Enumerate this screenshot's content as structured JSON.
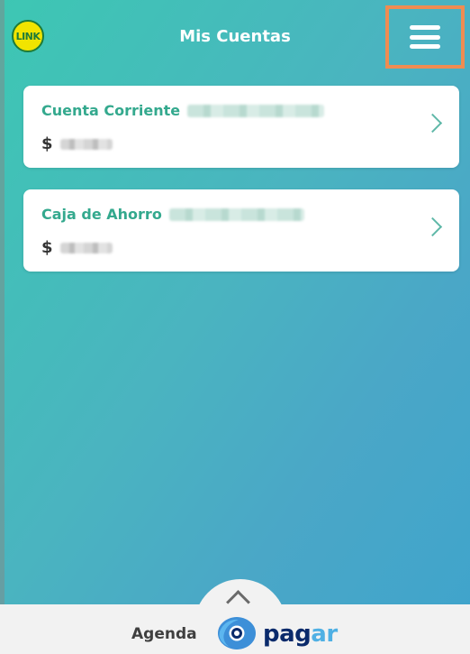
{
  "header": {
    "logo_text": "LINK",
    "title": "Mis Cuentas",
    "menu_icon": "hamburger-menu-icon"
  },
  "accounts": [
    {
      "name": "Cuenta Corriente",
      "currency_symbol": "$",
      "chevron_icon": "chevron-right-icon"
    },
    {
      "name": "Caja de Ahorro",
      "currency_symbol": "$",
      "chevron_icon": "chevron-right-icon"
    }
  ],
  "bottom_bar": {
    "pull_up_icon": "chevron-up-icon",
    "agenda_label": "Agenda",
    "pagar_brand_part1": "pag",
    "pagar_brand_part2": "ar"
  },
  "colors": {
    "accent_teal": "#34a98e",
    "highlight_orange": "#ef8c52",
    "pagar_dark": "#0a2a6b",
    "pagar_light": "#4fb0e4"
  }
}
